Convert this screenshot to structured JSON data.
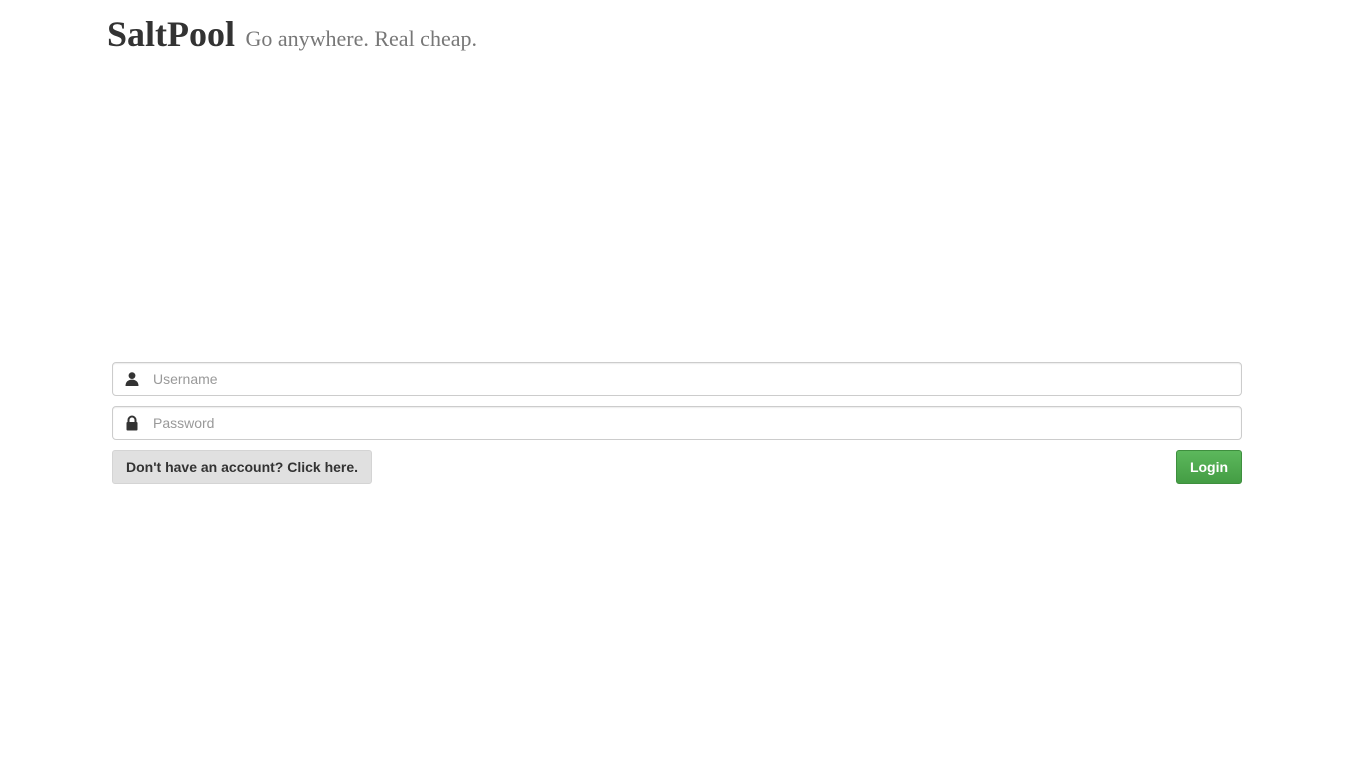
{
  "header": {
    "brand": "SaltPool",
    "tagline": "Go anywhere. Real cheap."
  },
  "login_form": {
    "username": {
      "value": "",
      "placeholder": "Username",
      "icon": "user-icon"
    },
    "password": {
      "value": "",
      "placeholder": "Password",
      "icon": "lock-icon"
    },
    "signup_label": "Don't have an account? Click here.",
    "login_label": "Login"
  },
  "colors": {
    "login_button": "#5cb85c",
    "signup_button": "#e0e0e0",
    "brand_text": "#333333",
    "tagline_text": "#777777"
  }
}
